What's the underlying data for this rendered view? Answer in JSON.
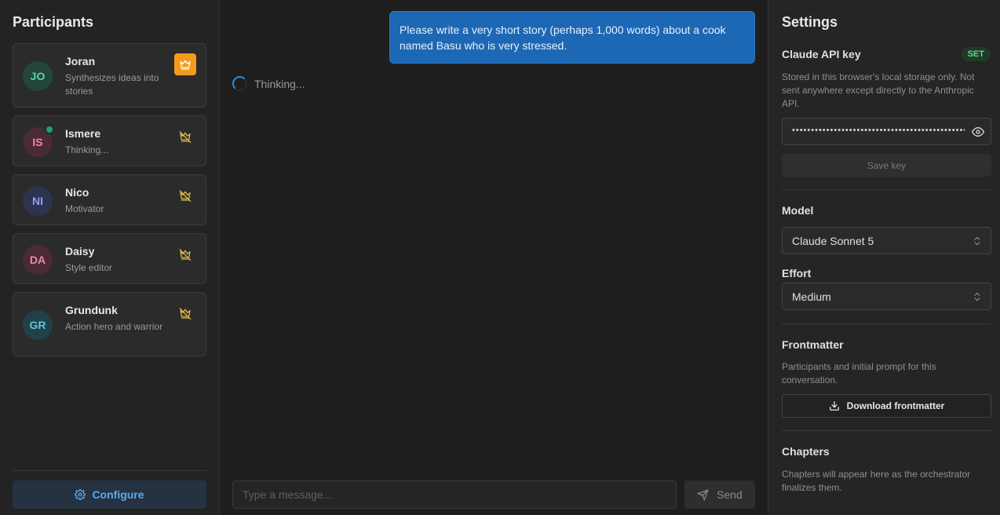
{
  "participants_panel": {
    "title": "Participants",
    "configure_label": "Configure"
  },
  "participants": [
    {
      "initials": "JO",
      "name": "Joran",
      "desc": "Synthesizes ideas into stories",
      "avatar_bg": "#23463a",
      "avatar_fg": "#5fd6a2",
      "is_orchestrator": true,
      "online": false
    },
    {
      "initials": "IS",
      "name": "Ismere",
      "desc": "Thinking...",
      "avatar_bg": "#4a2a34",
      "avatar_fg": "#f08aa6",
      "is_orchestrator": false,
      "online": true
    },
    {
      "initials": "NI",
      "name": "Nico",
      "desc": "Motivator",
      "avatar_bg": "#2f3352",
      "avatar_fg": "#8f9ff0",
      "is_orchestrator": false,
      "online": false
    },
    {
      "initials": "DA",
      "name": "Daisy",
      "desc": "Style editor",
      "avatar_bg": "#4a2a34",
      "avatar_fg": "#f08aa6",
      "is_orchestrator": false,
      "online": false
    },
    {
      "initials": "GR",
      "name": "Grundunk",
      "desc": "Action hero and warrior",
      "avatar_bg": "#21414a",
      "avatar_fg": "#5cc6dc",
      "is_orchestrator": false,
      "online": false
    }
  ],
  "chat": {
    "user_message": "Please write a very short story (perhaps 1,000 words) about a cook named Basu who is very stressed.",
    "status_text": "Thinking...",
    "input_placeholder": "Type a message...",
    "send_label": "Send"
  },
  "settings": {
    "title": "Settings",
    "api_key_label": "Claude API key",
    "api_key_badge": "SET",
    "api_key_help": "Stored in this browser's local storage only. Not sent anywhere except directly to the Anthropic API.",
    "api_key_mask": "••••••••••••••••••••••••••••••••••••••••••••••••••",
    "save_key_label": "Save key",
    "model_label": "Model",
    "model_value": "Claude Sonnet 5",
    "effort_label": "Effort",
    "effort_value": "Medium",
    "frontmatter_label": "Frontmatter",
    "frontmatter_help": "Participants and initial prompt for this conversation.",
    "download_label": "Download frontmatter",
    "chapters_label": "Chapters",
    "chapters_help": "Chapters will appear here as the orchestrator finalizes them."
  },
  "colors": {
    "accent": "#1d68b5",
    "crown_active": "#f29b1c",
    "crown_inactive": "#d9b84a",
    "online": "#1fa463"
  }
}
